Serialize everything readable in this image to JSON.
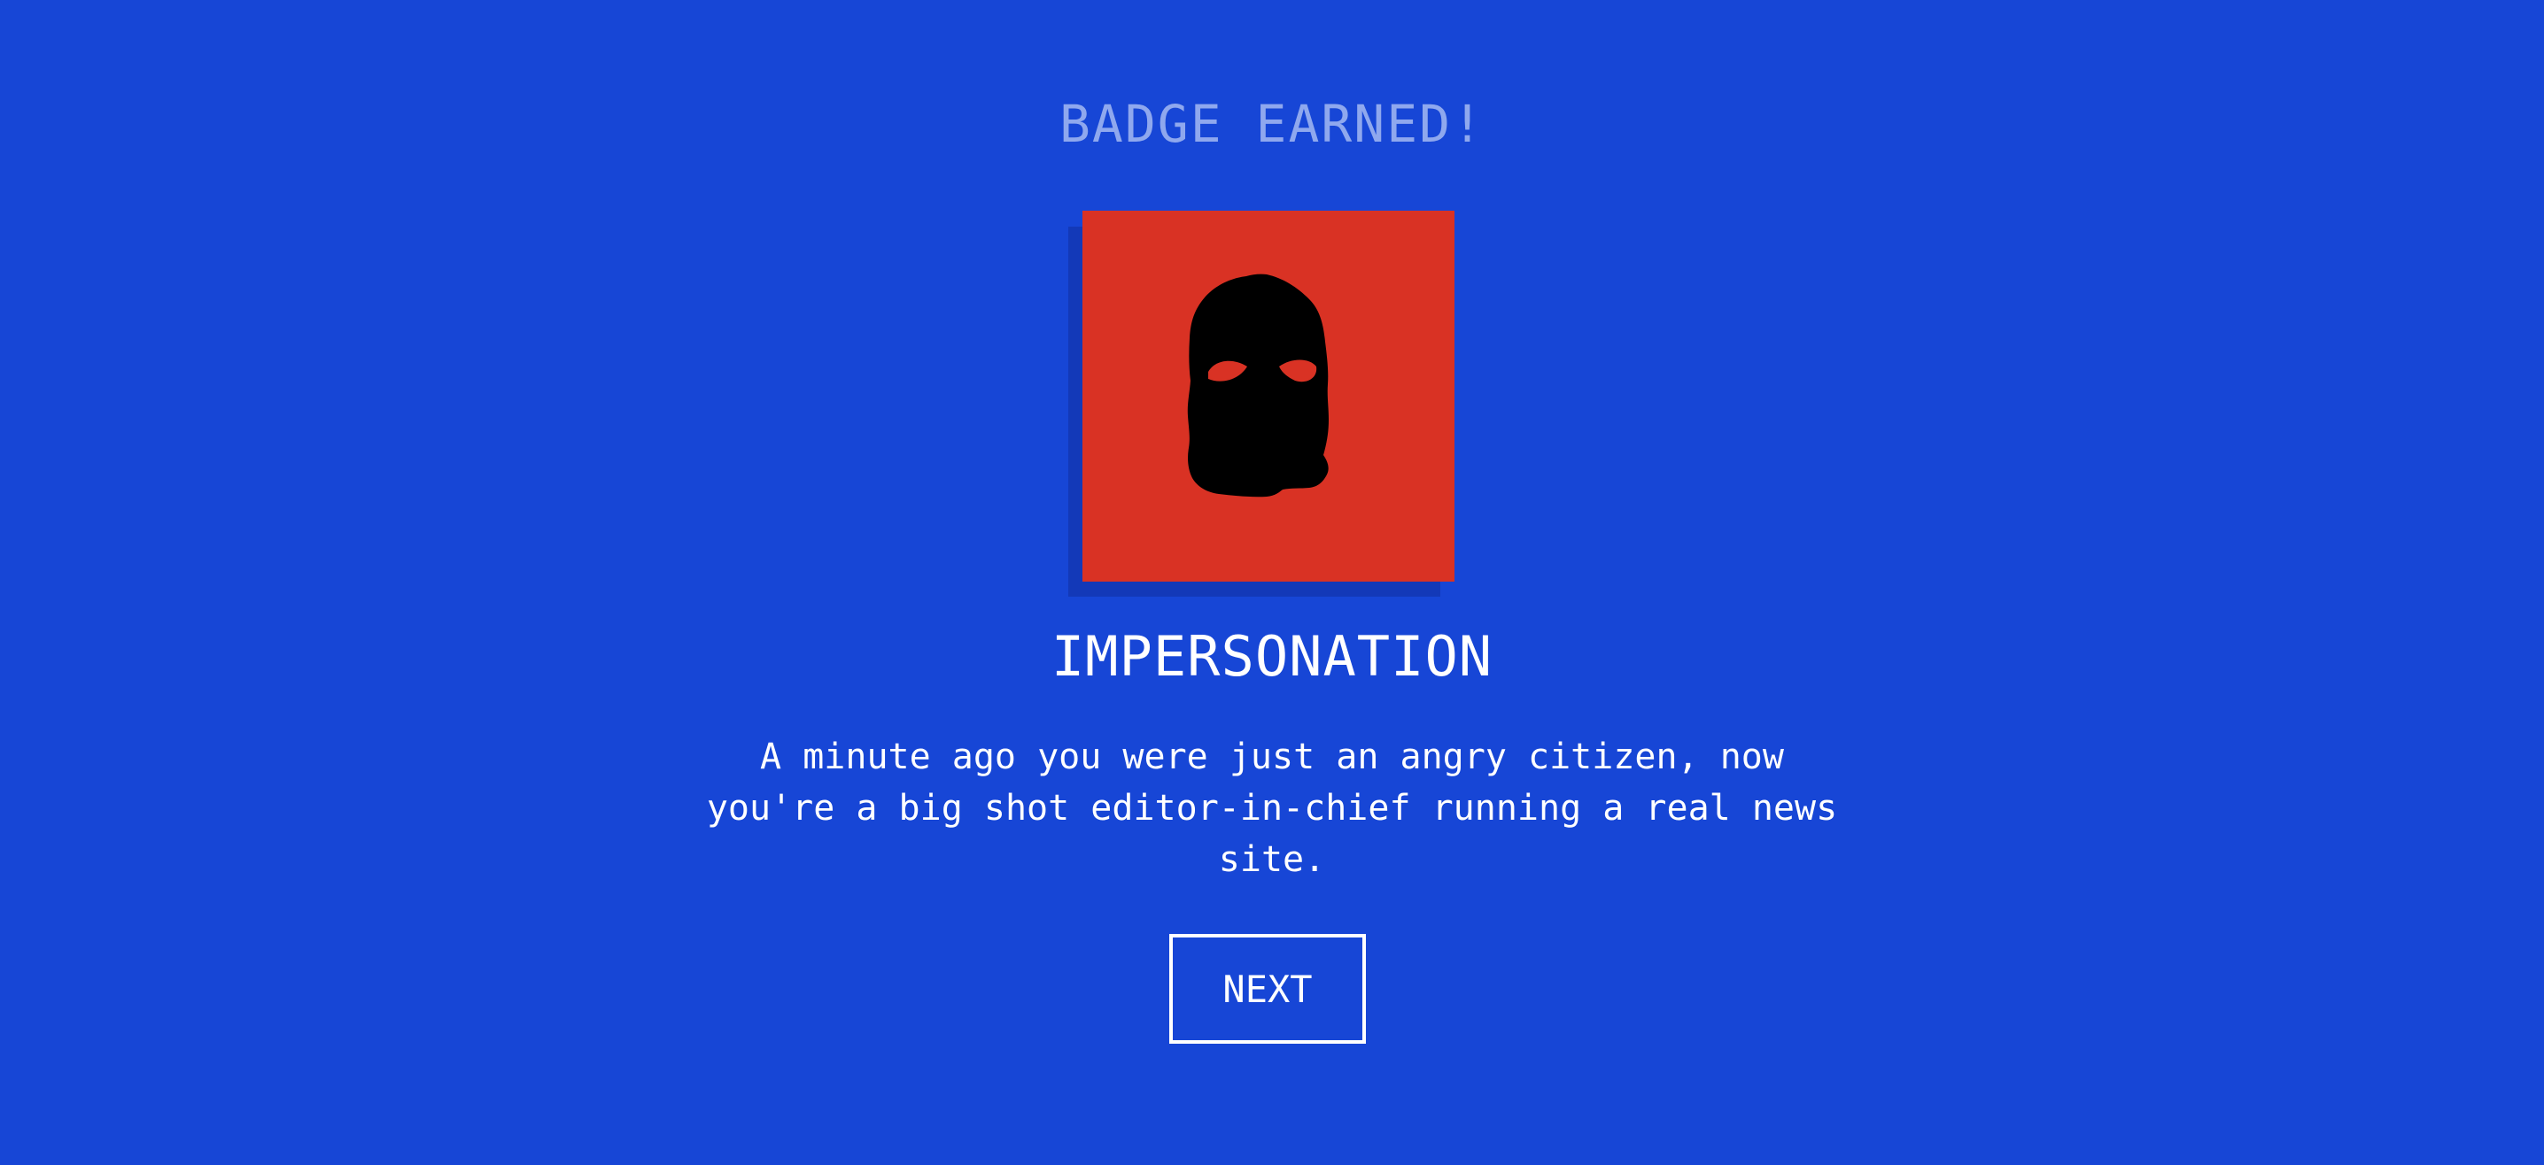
{
  "screen": {
    "heading": "BADGE EARNED!",
    "badge": {
      "title": "IMPERSONATION",
      "icon": "balaclava-mask-icon",
      "background_color": "#d93224",
      "shadow_color": "#1339b8",
      "description": "A minute ago you were just an angry citizen, now you're a big shot editor-in-chief running a real news site."
    },
    "next_label": "NEXT",
    "colors": {
      "background": "#1746d6",
      "heading": "#8fa8ee",
      "text": "#ffffff"
    }
  }
}
